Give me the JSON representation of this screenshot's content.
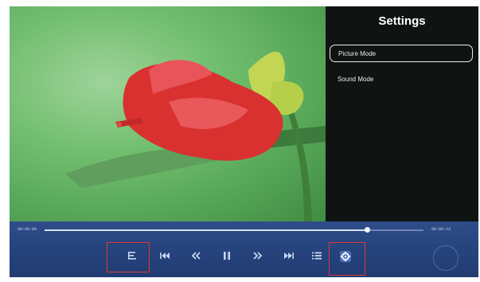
{
  "settings": {
    "title": "Settings",
    "items": [
      {
        "label": "Picture Mode",
        "selected": true
      },
      {
        "label": "Sound Mode",
        "selected": false
      }
    ]
  },
  "player": {
    "elapsed": "00:00:00",
    "total": "00:00:13",
    "progress": 0.85,
    "controls": [
      "subtitle-icon",
      "previous-icon",
      "rewind-icon",
      "pause-icon",
      "fast-forward-icon",
      "next-icon",
      "playlist-icon",
      "settings-gear-icon"
    ],
    "highlighted": [
      "subtitle-icon",
      "settings-gear-icon"
    ]
  },
  "colors": {
    "accent": "#2b4a87",
    "highlight": "#e23636",
    "flower": "#d9312f"
  }
}
